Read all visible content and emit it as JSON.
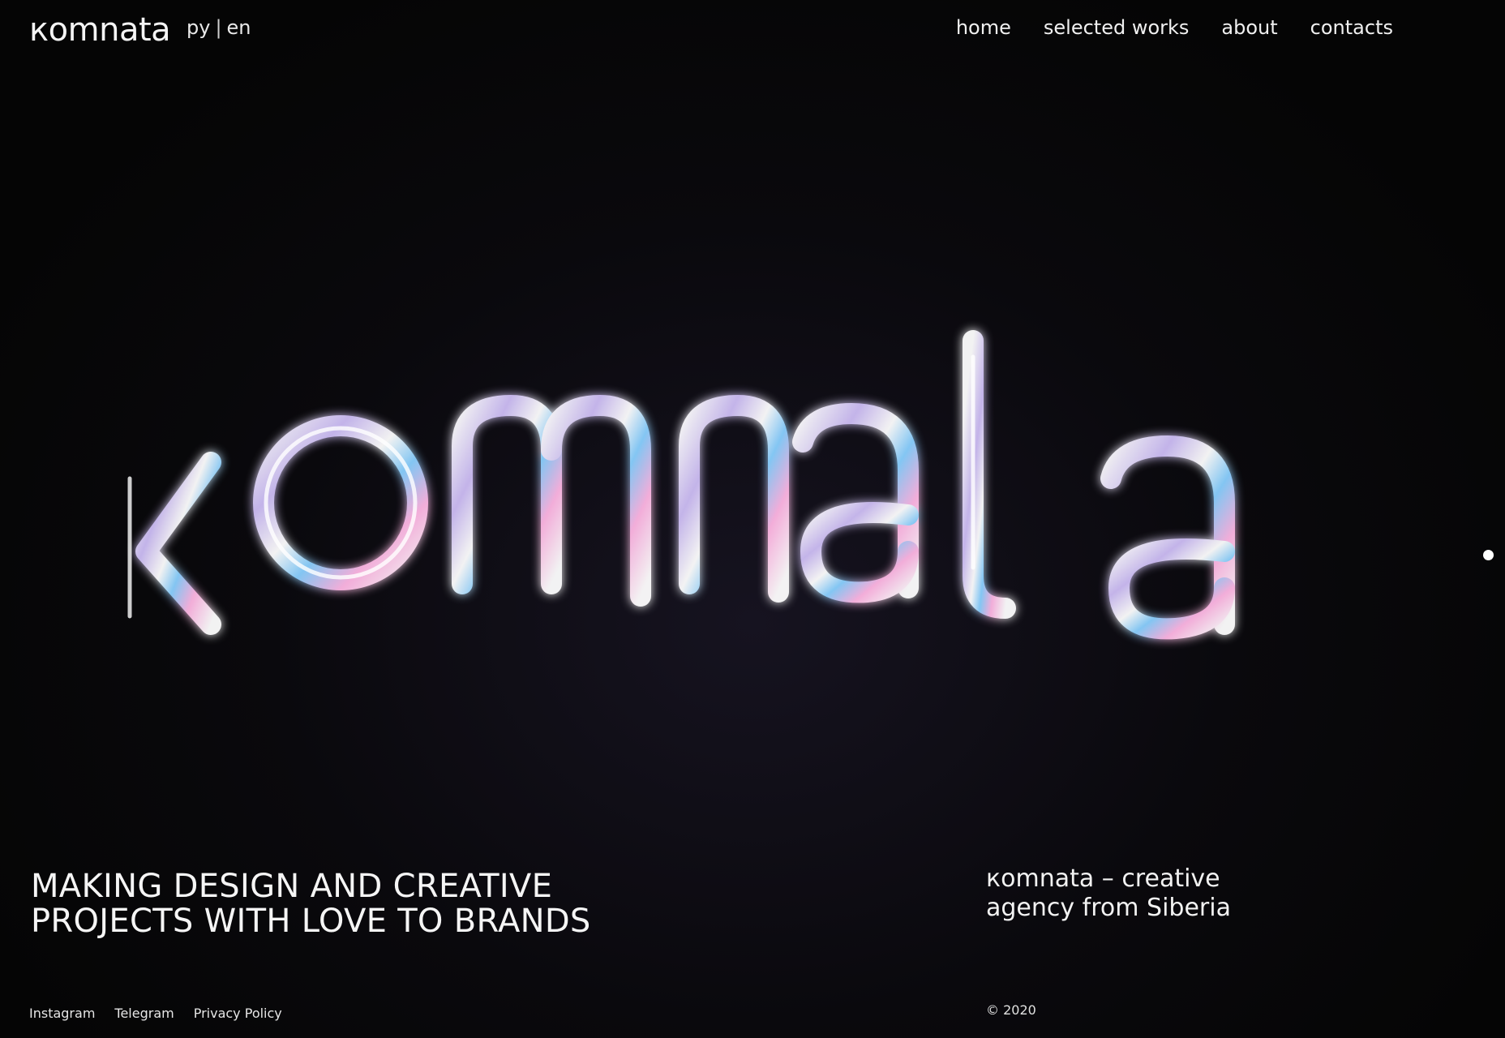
{
  "header": {
    "logo": "кomnata",
    "lang": {
      "ru": "ру",
      "separator": "|",
      "en": "en"
    },
    "nav": [
      "home",
      "selected works",
      "about",
      "contacts"
    ]
  },
  "hero": {
    "wordmark": "кomnata",
    "accent_colors": [
      "#d8c8ff",
      "#ffffff",
      "#9fd7ff",
      "#ffb8e6"
    ]
  },
  "tagline": {
    "line1": "MAKING DESIGN AND CREATIVE",
    "line2": "PROJECTS WITH LOVE TO BRANDS"
  },
  "about": {
    "line1": "кomnata – creative",
    "line2": "agency from Siberia"
  },
  "footer": {
    "links": [
      "Instagram",
      "Telegram",
      "Privacy Policy"
    ],
    "copyright": "© 2020"
  }
}
